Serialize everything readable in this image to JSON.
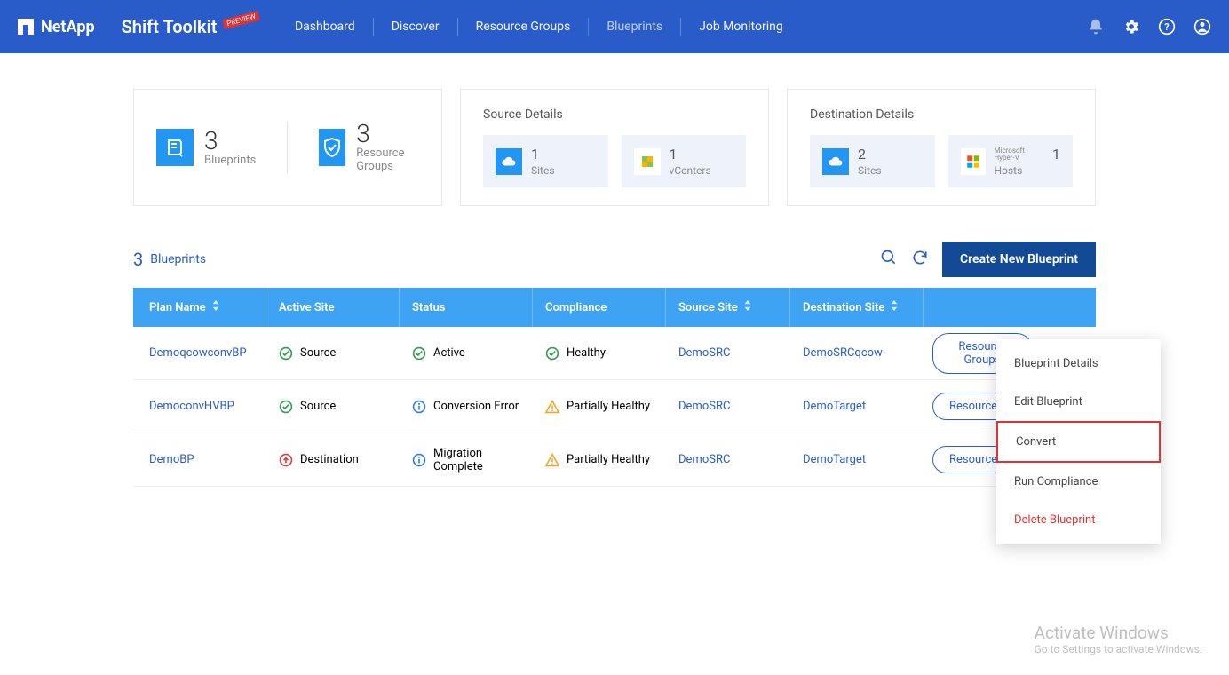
{
  "header": {
    "brand": "NetApp",
    "app_title": "Shift Toolkit",
    "preview_label": "PREVIEW",
    "nav": [
      "Dashboard",
      "Discover",
      "Resource Groups",
      "Blueprints",
      "Job Monitoring"
    ],
    "nav_selected": 3
  },
  "summary_left": {
    "blueprints": {
      "count": "3",
      "label": "Blueprints"
    },
    "resource_groups": {
      "count": "3",
      "label": "Resource Groups"
    }
  },
  "source_details": {
    "title": "Source Details",
    "sites": {
      "count": "1",
      "label": "Sites"
    },
    "vcenters": {
      "count": "1",
      "label": "vCenters"
    }
  },
  "destination_details": {
    "title": "Destination Details",
    "sites": {
      "count": "2",
      "label": "Sites"
    },
    "hosts": {
      "count": "1",
      "label": "Hosts",
      "host_type": "Microsoft Hyper-V"
    }
  },
  "list_header": {
    "count": "3",
    "label": "Blueprints",
    "create_button": "Create New Blueprint"
  },
  "columns": {
    "plan": "Plan Name",
    "active": "Active Site",
    "status": "Status",
    "compliance": "Compliance",
    "source": "Source Site",
    "destination": "Destination Site"
  },
  "rows": [
    {
      "plan": "DemoqcowconvBP",
      "active": "Source",
      "active_icon": "check-green",
      "status": "Active",
      "status_icon": "check-green",
      "compliance": "Healthy",
      "compliance_icon": "check-green",
      "source": "DemoSRC",
      "destination": "DemoSRCqcow",
      "rg_button": "Resource Groups"
    },
    {
      "plan": "DemoconvHVBP",
      "active": "Source",
      "active_icon": "check-green",
      "status": "Conversion Error",
      "status_icon": "info-blue",
      "compliance": "Partially Healthy",
      "compliance_icon": "warn-orange",
      "source": "DemoSRC",
      "destination": "DemoTarget",
      "rg_button": "Resource G"
    },
    {
      "plan": "DemoBP",
      "active": "Destination",
      "active_icon": "up-red",
      "status": "Migration Complete",
      "status_icon": "info-blue",
      "compliance": "Partially Healthy",
      "compliance_icon": "warn-orange",
      "source": "DemoSRC",
      "destination": "DemoTarget",
      "rg_button": "Resource G"
    }
  ],
  "dropdown": {
    "items": [
      {
        "label": "Blueprint Details"
      },
      {
        "label": "Edit Blueprint"
      },
      {
        "label": "Convert",
        "highlight": true
      },
      {
        "label": "Run Compliance"
      },
      {
        "label": "Delete Blueprint",
        "danger": true
      }
    ]
  },
  "watermark": {
    "l1": "Activate Windows",
    "l2": "Go to Settings to activate Windows."
  }
}
